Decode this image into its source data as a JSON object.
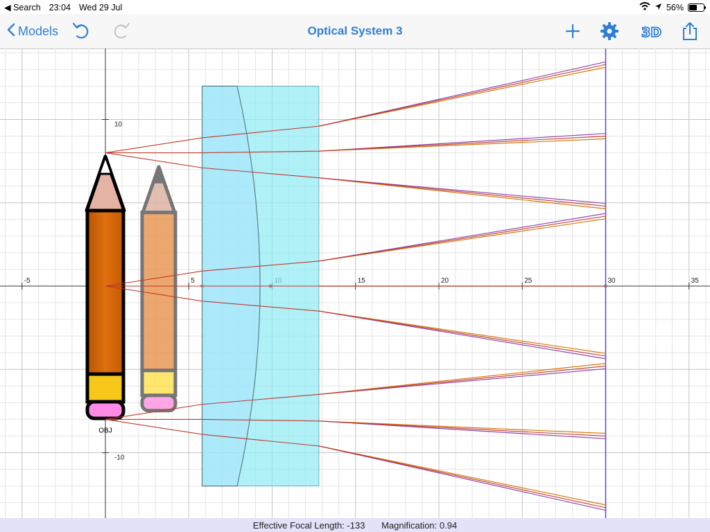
{
  "status_bar": {
    "back_app": "◀ Search",
    "time": "23:04",
    "date": "Wed 29 Jul",
    "battery": "56%",
    "battery_level": 0.56
  },
  "nav": {
    "back_label": "Models",
    "title": "Optical System 3",
    "icons": [
      "chevron-left-icon",
      "undo-icon",
      "redo-icon",
      "plus-icon",
      "gear-icon",
      "3d-icon",
      "share-icon"
    ],
    "accent_color": "#2f7fd6"
  },
  "plot": {
    "x_ticks": [
      "-5",
      "5",
      "10",
      "15",
      "20",
      "25",
      "30",
      "35"
    ],
    "y_ticks": [
      "10",
      "-10"
    ],
    "object_label": "OBJ"
  },
  "footer": {
    "focal_length": "Effective Focal Length: -133",
    "magnification": "Magnification: 0.94"
  },
  "chart_data": {
    "type": "scatter",
    "xlim": [
      -6.3,
      36
    ],
    "ylim": [
      -14,
      14
    ],
    "grid": true,
    "ray_colors": [
      "#c0392b",
      "#8e44ad",
      "#d4780a"
    ],
    "lens": {
      "x_start": 5.8,
      "x_end": 12.8,
      "y_top": 12,
      "y_bottom": -12,
      "color": "#8ee9f3"
    },
    "screen_x": 30,
    "object": {
      "x": 0,
      "y_top": 8,
      "y_bottom": -8
    },
    "image": {
      "x": 3.2,
      "y_top": 7.5,
      "y_bottom": -7.4
    },
    "rays": [
      {
        "points": [
          [
            0,
            8
          ],
          [
            5.8,
            8.9
          ],
          [
            12.8,
            9.6
          ],
          [
            30,
            13.3
          ]
        ]
      },
      {
        "points": [
          [
            0,
            8
          ],
          [
            5.8,
            8
          ],
          [
            12.8,
            8.1
          ],
          [
            30,
            9
          ]
        ]
      },
      {
        "points": [
          [
            0,
            8
          ],
          [
            5.8,
            7.1
          ],
          [
            12.8,
            6.5
          ],
          [
            30,
            4.8
          ]
        ]
      },
      {
        "points": [
          [
            0,
            0
          ],
          [
            5.8,
            0.9
          ],
          [
            12.8,
            1.5
          ],
          [
            30,
            4.2
          ]
        ]
      },
      {
        "points": [
          [
            0,
            0
          ],
          [
            5.8,
            0
          ],
          [
            12.8,
            0
          ],
          [
            30,
            0
          ]
        ]
      },
      {
        "points": [
          [
            0,
            0
          ],
          [
            5.8,
            -0.9
          ],
          [
            12.8,
            -1.5
          ],
          [
            30,
            -4.2
          ]
        ]
      },
      {
        "points": [
          [
            0,
            -8
          ],
          [
            5.8,
            -7.1
          ],
          [
            12.8,
            -6.5
          ],
          [
            30,
            -4.8
          ]
        ]
      },
      {
        "points": [
          [
            0,
            -8
          ],
          [
            5.8,
            -8
          ],
          [
            12.8,
            -8.1
          ],
          [
            30,
            -9
          ]
        ]
      },
      {
        "points": [
          [
            0,
            -8
          ],
          [
            5.8,
            -8.9
          ],
          [
            12.8,
            -9.6
          ],
          [
            30,
            -13.3
          ]
        ]
      }
    ]
  }
}
